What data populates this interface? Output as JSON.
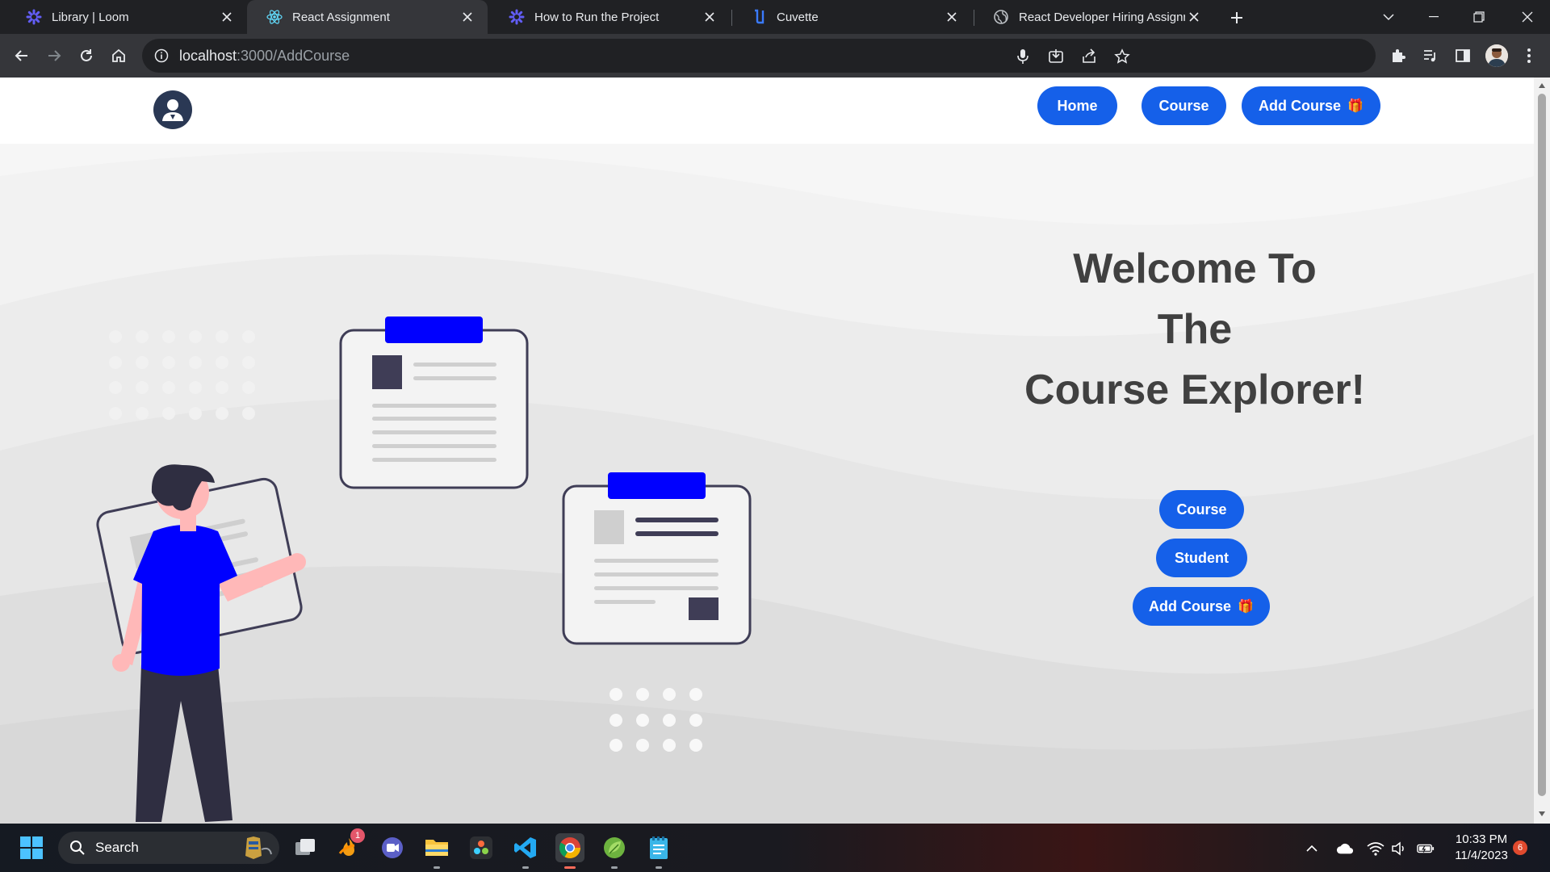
{
  "browser": {
    "tabs": [
      {
        "title": "Library | Loom",
        "icon": "loom-icon"
      },
      {
        "title": "React Assignment",
        "icon": "react-icon"
      },
      {
        "title": "How to Run the Project",
        "icon": "loom-icon"
      },
      {
        "title": "Cuvette",
        "icon": "cuvette-icon"
      },
      {
        "title": "React Developer Hiring Assignm",
        "icon": "globe-icon"
      }
    ],
    "active_tab": 1,
    "url_host": "localhost",
    "url_path": ":3000/AddCourse"
  },
  "site": {
    "nav": {
      "home": "Home",
      "course": "Course",
      "add_course": "Add Course",
      "gift": "🎁"
    },
    "welcome": {
      "line1": "Welcome To",
      "line2": "The",
      "line3": "Course Explorer!"
    },
    "actions": {
      "course": "Course",
      "student": "Student",
      "add_course": "Add Course",
      "gift": "🎁"
    },
    "colors": {
      "primary": "#1560e9",
      "accent_blue": "#0000ff",
      "dark": "#2f2e41"
    }
  },
  "taskbar": {
    "search_placeholder": "Search",
    "time": "10:33 PM",
    "date": "11/4/2023",
    "notification_count": "6",
    "app_badge": "1"
  }
}
